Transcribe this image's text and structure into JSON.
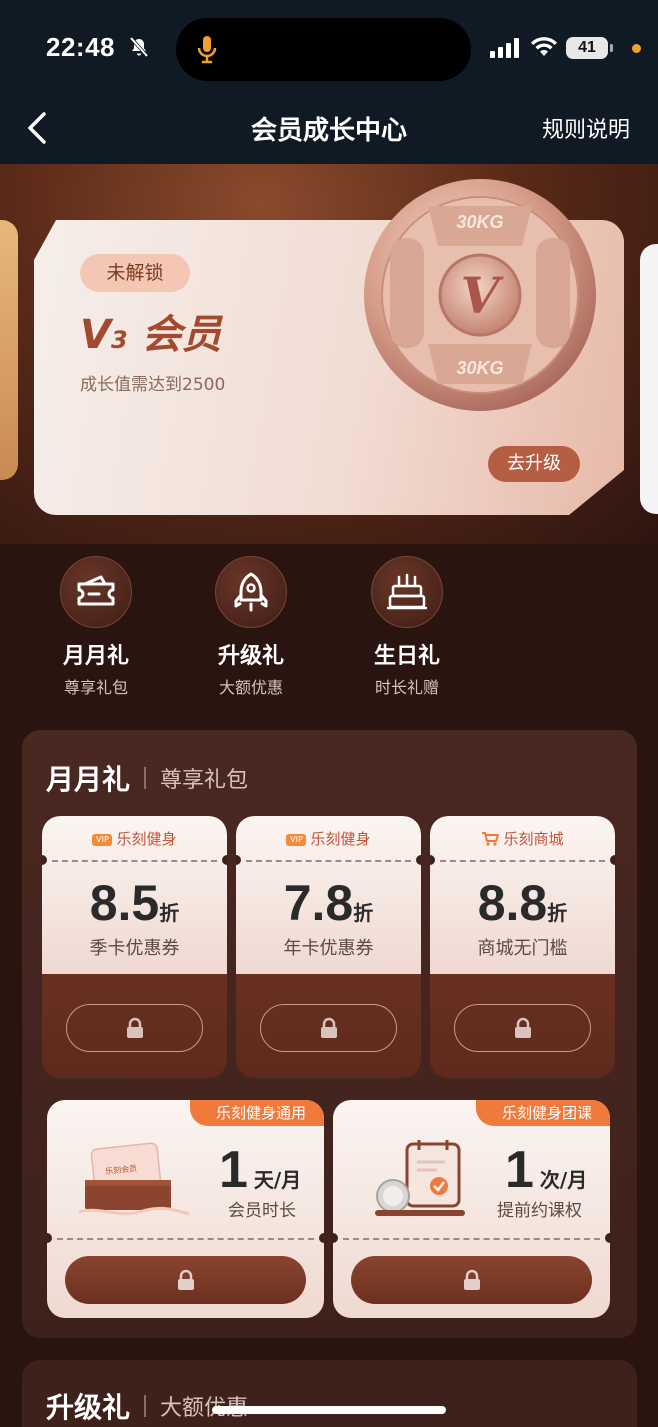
{
  "status": {
    "time": "22:48",
    "battery": "41"
  },
  "nav": {
    "title": "会员成长中心",
    "rules": "规则说明"
  },
  "hero": {
    "badge": "未解锁",
    "level_main": "V",
    "level_num": "3",
    "level_suffix": "会员",
    "desc": "成长值需达到2500",
    "upgrade": "去升级",
    "plate_text_top": "30KG",
    "plate_text_bottom": "30KG",
    "plate_letter": "V"
  },
  "benefits": [
    {
      "title": "月月礼",
      "sub": "尊享礼包",
      "icon": "ticket-icon"
    },
    {
      "title": "升级礼",
      "sub": "大额优惠",
      "icon": "rocket-icon"
    },
    {
      "title": "生日礼",
      "sub": "时长礼赠",
      "icon": "cake-icon"
    }
  ],
  "monthly": {
    "title": "月月礼",
    "sub": "尊享礼包",
    "coupons": [
      {
        "tag": "乐刻健身",
        "tag_icon": "vip-icon",
        "num": "8.5",
        "unit": "折",
        "desc": "季卡优惠券"
      },
      {
        "tag": "乐刻健身",
        "tag_icon": "vip-icon",
        "num": "7.8",
        "unit": "折",
        "desc": "年卡优惠券"
      },
      {
        "tag": "乐刻商城",
        "tag_icon": "cart-icon",
        "num": "8.8",
        "unit": "折",
        "desc": "商城无门槛"
      }
    ],
    "wide": [
      {
        "ribbon": "乐刻健身通用",
        "num": "1",
        "unit": "天/月",
        "desc": "会员时长",
        "box_label": "乐刻会员"
      },
      {
        "ribbon": "乐刻健身团课",
        "num": "1",
        "unit": "次/月",
        "desc": "提前约课权"
      }
    ]
  },
  "upgrade": {
    "title": "升级礼",
    "sub": "大额优惠"
  }
}
